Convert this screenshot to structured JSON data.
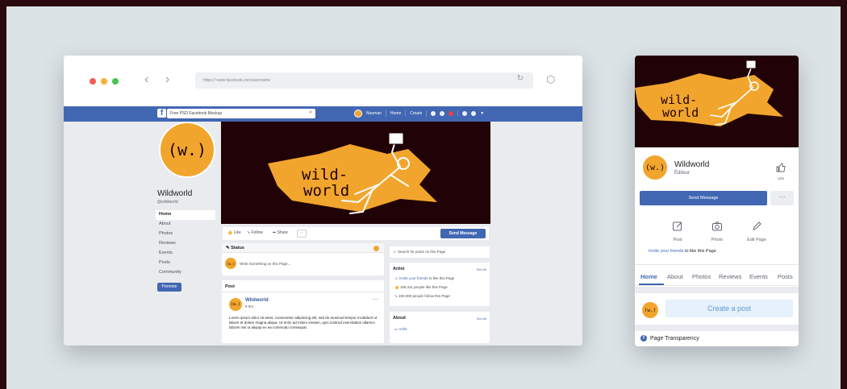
{
  "browser": {
    "url": "https:// www.facebook.com/username"
  },
  "fb_header": {
    "search_text": "Free PSD Facebook Mockup",
    "user_name": "Nouman",
    "home": "Home",
    "create": "Create"
  },
  "page": {
    "logo_text": "(w.)",
    "name": "Wildworld",
    "handle": "@wildworld",
    "nav": [
      "Home",
      "About",
      "Photos",
      "Reviews",
      "Events",
      "Posts",
      "Community"
    ],
    "promote": "Promote",
    "cover_text_1": "wild-",
    "cover_text_2": "world"
  },
  "actions": {
    "like": "Like",
    "follow": "Follow",
    "share": "Share",
    "more": "···",
    "send_message": "Send Message"
  },
  "status_card": {
    "title": "Status",
    "placeholder": "Write Something on this Page..."
  },
  "post_card": {
    "header": "Post",
    "author": "Wildworld",
    "time": "9 hrs",
    "more": "···",
    "body": "Lorem ipsum dolor sit amet, consectetur adipiscing elit, sed do eiusmod tempor incididunt ut labore et dolore magna aliqua. Ut enim ad minim veniam, quis nostrud exercitation ullamco laboris nisi ut aliquip ex ea commodo consequat."
  },
  "right_col": {
    "search_placeholder": "Search for posts on this Page",
    "artist_title": "Artist",
    "see_all": "See All",
    "invite_link": "Invite your friends",
    "invite_rest": " to like this Page",
    "likes": "190,411 people like this Page",
    "follows": "190,000 people follow this Page",
    "about_title": "About",
    "about_item": "Artist"
  },
  "mobile": {
    "name": "Wildworld",
    "category": "Éditeur",
    "like_label": "Like",
    "send_message": "Send Message",
    "more": "···",
    "actions": [
      "Post",
      "Photo",
      "Edit Page"
    ],
    "invite_link": "Invite your friends",
    "invite_rest": " to like this Page",
    "tabs": [
      "Home",
      "About",
      "Photos",
      "Reviews",
      "Events",
      "Posts"
    ],
    "create_post": "Create a post",
    "transparency": "Page Transparency"
  },
  "colors": {
    "fb_blue": "#4267b2",
    "brand_orange": "#f2a52d",
    "cover_dark": "#210206",
    "backdrop": "#dce3e6"
  },
  "icons": [
    "close-dot-icon",
    "minimize-dot-icon",
    "maximize-dot-icon",
    "back-arrow-icon",
    "forward-arrow-icon",
    "reload-icon",
    "extension-icon",
    "facebook-logo-icon",
    "search-icon",
    "status-pencil-icon",
    "like-thumb-icon",
    "camera-icon",
    "pencil-icon",
    "post-compose-icon",
    "facebook-circle-icon"
  ]
}
